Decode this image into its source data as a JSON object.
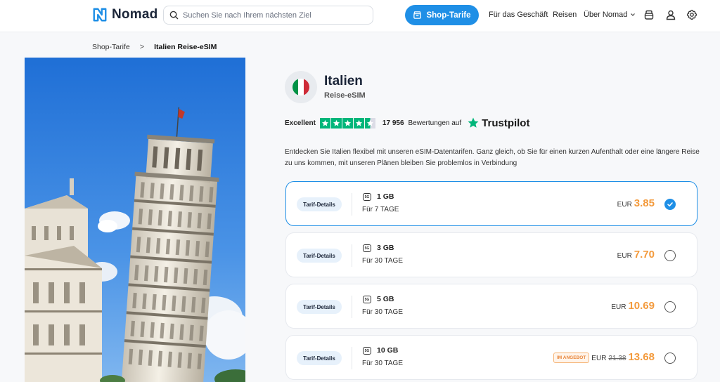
{
  "header": {
    "logo_text": "Nomad",
    "search_placeholder": "Suchen Sie nach Ihrem nächsten Ziel",
    "shop_button": "Shop-Tarife",
    "nav": {
      "business": "Für das Geschäft",
      "travel": "Reisen",
      "about": "Über Nomad"
    },
    "icons": [
      "bag-icon",
      "user-icon",
      "gear-icon"
    ],
    "accent_color": "#1f8fe6"
  },
  "breadcrumb": {
    "parent": "Shop-Tarife",
    "separator": ">",
    "current": "Italien Reise-eSIM"
  },
  "product": {
    "title": "Italien",
    "subtitle": "Reise-eSIM",
    "flag_colors": [
      "#009246",
      "#ffffff",
      "#ce2b37"
    ]
  },
  "rating": {
    "word": "Excellent",
    "stars": 4.5,
    "count": "17 956",
    "text": "Bewertungen auf",
    "brand": "Trustpilot"
  },
  "description": "Entdecken Sie Italien flexibel mit unseren eSIM-Datentarifen. Ganz gleich, ob Sie für einen kurzen Aufenthalt oder eine längere Reise zu uns kommen, mit unseren Plänen bleiben Sie problemlos in Verbindung",
  "plans": [
    {
      "details": "Tarif-Details",
      "network": "5G",
      "data": "1 GB",
      "duration": "Für 7 TAGE",
      "currency": "EUR",
      "price": "3.85",
      "old_price": "",
      "offer": "",
      "selected": true
    },
    {
      "details": "Tarif-Details",
      "network": "5G",
      "data": "3 GB",
      "duration": "Für 30 TAGE",
      "currency": "EUR",
      "price": "7.70",
      "old_price": "",
      "offer": "",
      "selected": false
    },
    {
      "details": "Tarif-Details",
      "network": "5G",
      "data": "5 GB",
      "duration": "Für 30 TAGE",
      "currency": "EUR",
      "price": "10.69",
      "old_price": "",
      "offer": "",
      "selected": false
    },
    {
      "details": "Tarif-Details",
      "network": "5G",
      "data": "10 GB",
      "duration": "Für 30 TAGE",
      "currency": "EUR",
      "price": "13.68",
      "old_price": "21.38",
      "offer": "IM ANGEBOT",
      "selected": false
    }
  ],
  "price_color": "#f39a3c"
}
